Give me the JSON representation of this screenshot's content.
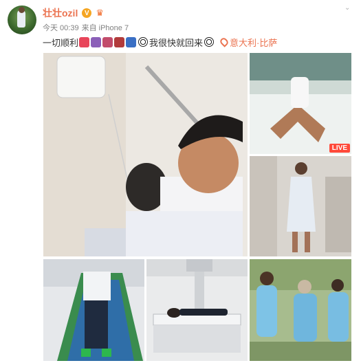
{
  "user": {
    "name": "壮壮ozil",
    "verified_badge": "V"
  },
  "meta": {
    "time": "今天 00:39",
    "source": "来自 iPhone 7"
  },
  "post": {
    "text_1": "一切顺利",
    "text_2": "我很快就回来",
    "location": "意大利·比萨"
  },
  "photos": {
    "live_badge": "LIVE"
  },
  "colors": {
    "accent": "#eb7350",
    "badge": "#f5a623",
    "live": "#ff4a3a"
  },
  "icons": [
    "crown-icon",
    "chevron-down-icon",
    "location-pin-icon",
    "soccer-ball-icon"
  ]
}
